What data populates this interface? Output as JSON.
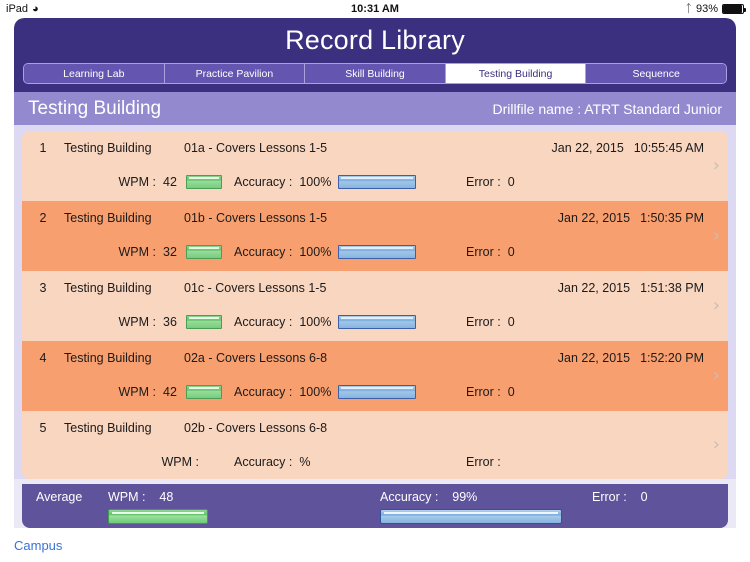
{
  "status_bar": {
    "carrier": "iPad",
    "wifi_icon": "wifi-icon",
    "time": "10:31 AM",
    "bluetooth_icon": "bluetooth-icon",
    "battery_percent": "93%",
    "battery_level": 93
  },
  "header": {
    "title": "Record Library"
  },
  "tabs": [
    {
      "label": "Learning Lab",
      "active": false
    },
    {
      "label": "Practice Pavilion",
      "active": false
    },
    {
      "label": "Skill Building",
      "active": false
    },
    {
      "label": "Testing Building",
      "active": true
    },
    {
      "label": "Sequence",
      "active": false
    }
  ],
  "subheader": {
    "title": "Testing Building",
    "drillfile": "Drillfile name : ATRT Standard Junior"
  },
  "labels": {
    "wpm": "WPM :",
    "accuracy": "Accuracy :",
    "accuracy_avg": "Accuracy :",
    "error": "Error :",
    "average": "Average",
    "percent_sign": "%",
    "chevron": "›"
  },
  "rows": [
    {
      "index": "1",
      "building": "Testing Building",
      "drill": "01a - Covers Lessons 1-5",
      "date": "Jan 22, 2015",
      "time": "10:55:45 AM",
      "wpm": "42",
      "accuracy": "100%",
      "error": "0"
    },
    {
      "index": "2",
      "building": "Testing Building",
      "drill": "01b - Covers Lessons 1-5",
      "date": "Jan 22, 2015",
      "time": "1:50:35 PM",
      "wpm": "32",
      "accuracy": "100%",
      "error": "0"
    },
    {
      "index": "3",
      "building": "Testing Building",
      "drill": "01c - Covers Lessons 1-5",
      "date": "Jan 22, 2015",
      "time": "1:51:38 PM",
      "wpm": "36",
      "accuracy": "100%",
      "error": "0"
    },
    {
      "index": "4",
      "building": "Testing Building",
      "drill": "02a - Covers Lessons 6-8",
      "date": "Jan 22, 2015",
      "time": "1:52:20 PM",
      "wpm": "42",
      "accuracy": "100%",
      "error": "0"
    },
    {
      "index": "5",
      "building": "Testing Building",
      "drill": "02b - Covers Lessons 6-8",
      "date": "",
      "time": "",
      "wpm": "",
      "accuracy": "%",
      "error": ""
    }
  ],
  "average": {
    "label": "Average",
    "wpm_label": "WPM :",
    "wpm_value": "48",
    "accuracy_label": "Accuracy :",
    "accuracy_value": "99%",
    "error_label": "Error :",
    "error_value": "0"
  },
  "footer": {
    "campus_link": "Campus"
  },
  "colors": {
    "header_purple": "#3b2f80",
    "tab_purple": "#6456b0",
    "subheader_purple": "#9389cf",
    "panel_bg": "#ded9f2",
    "row_odd": "#f9d6c0",
    "row_even": "#f79f6e",
    "avg_bar": "#5f539b",
    "link_blue": "#3a72d8"
  }
}
